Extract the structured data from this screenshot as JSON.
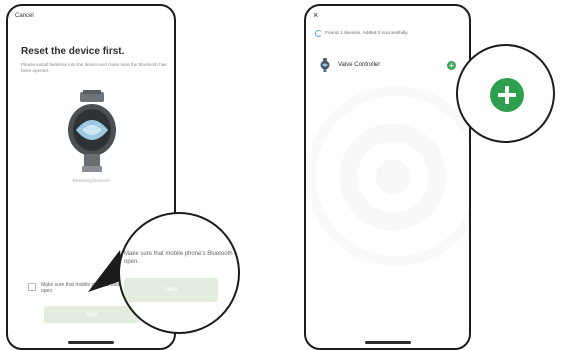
{
  "left_screen": {
    "cancel": "Cancel",
    "sub_tabs": "",
    "title": "Reset the device first.",
    "description": "Please install batteries into the device and make sure the Bluetooth has been opened.",
    "status": "Resetting Devices",
    "checkbox_label": "Make sure that mobile phone's Bluetooth is open.",
    "next": "Next"
  },
  "left_magnifier": {
    "text": "Make sure that mobile phone's Bluetooth is open.",
    "next": "Next"
  },
  "right_screen": {
    "close": "×",
    "found_text": "Found 1 devices. Added 0 successfully.",
    "device_name": "Valve Controller",
    "add_symbol": "+"
  },
  "colors": {
    "accent_green": "#2f9e4f",
    "disabled_button": "#e3eddf"
  },
  "icons": {
    "close": "close-icon",
    "loading": "spinner-icon",
    "valve": "valve-controller-icon",
    "add": "plus-icon"
  }
}
